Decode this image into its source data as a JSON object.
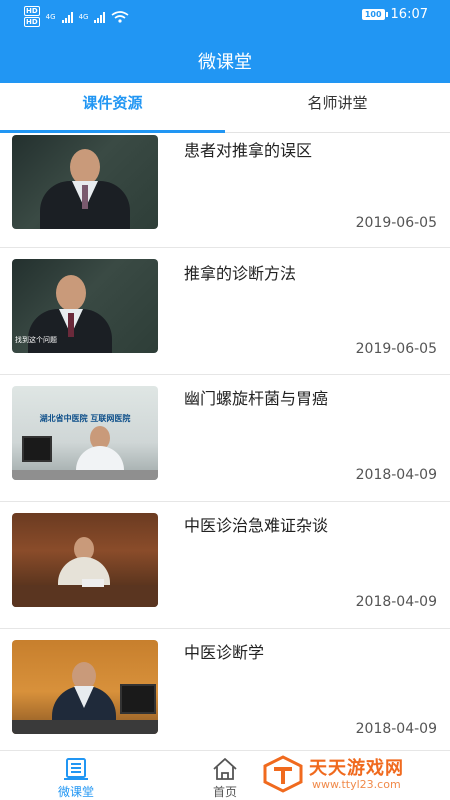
{
  "status_bar": {
    "hd1": "HD",
    "hd2": "HD",
    "net1": "4G",
    "net2": "4G",
    "battery": "100",
    "time": "16:07"
  },
  "header": {
    "title": "微课堂"
  },
  "tabs": [
    {
      "label": "课件资源",
      "active": true
    },
    {
      "label": "名师讲堂",
      "active": false
    }
  ],
  "courses": [
    {
      "title": "患者对推拿的误区",
      "date": "2019-06-05",
      "thumb_caption": ""
    },
    {
      "title": "推拿的诊断方法",
      "date": "2019-06-05",
      "thumb_caption": "找到这个问题"
    },
    {
      "title": "幽门螺旋杆菌与胃癌",
      "date": "2018-04-09",
      "thumb_caption": "湖北省中医院 互联网医院"
    },
    {
      "title": "中医诊治急难证杂谈",
      "date": "2018-04-09",
      "thumb_caption": ""
    },
    {
      "title": "中医诊断学",
      "date": "2018-04-09",
      "thumb_caption": ""
    }
  ],
  "bottom_nav": [
    {
      "label": "微课堂",
      "icon": "course-icon",
      "active": true
    },
    {
      "label": "首页",
      "icon": "home-icon",
      "active": false
    }
  ],
  "watermark": {
    "title": "天天游戏网",
    "url": "www.ttyl23.com"
  },
  "colors": {
    "accent": "#2196f3",
    "watermark": "#f06a1e"
  }
}
